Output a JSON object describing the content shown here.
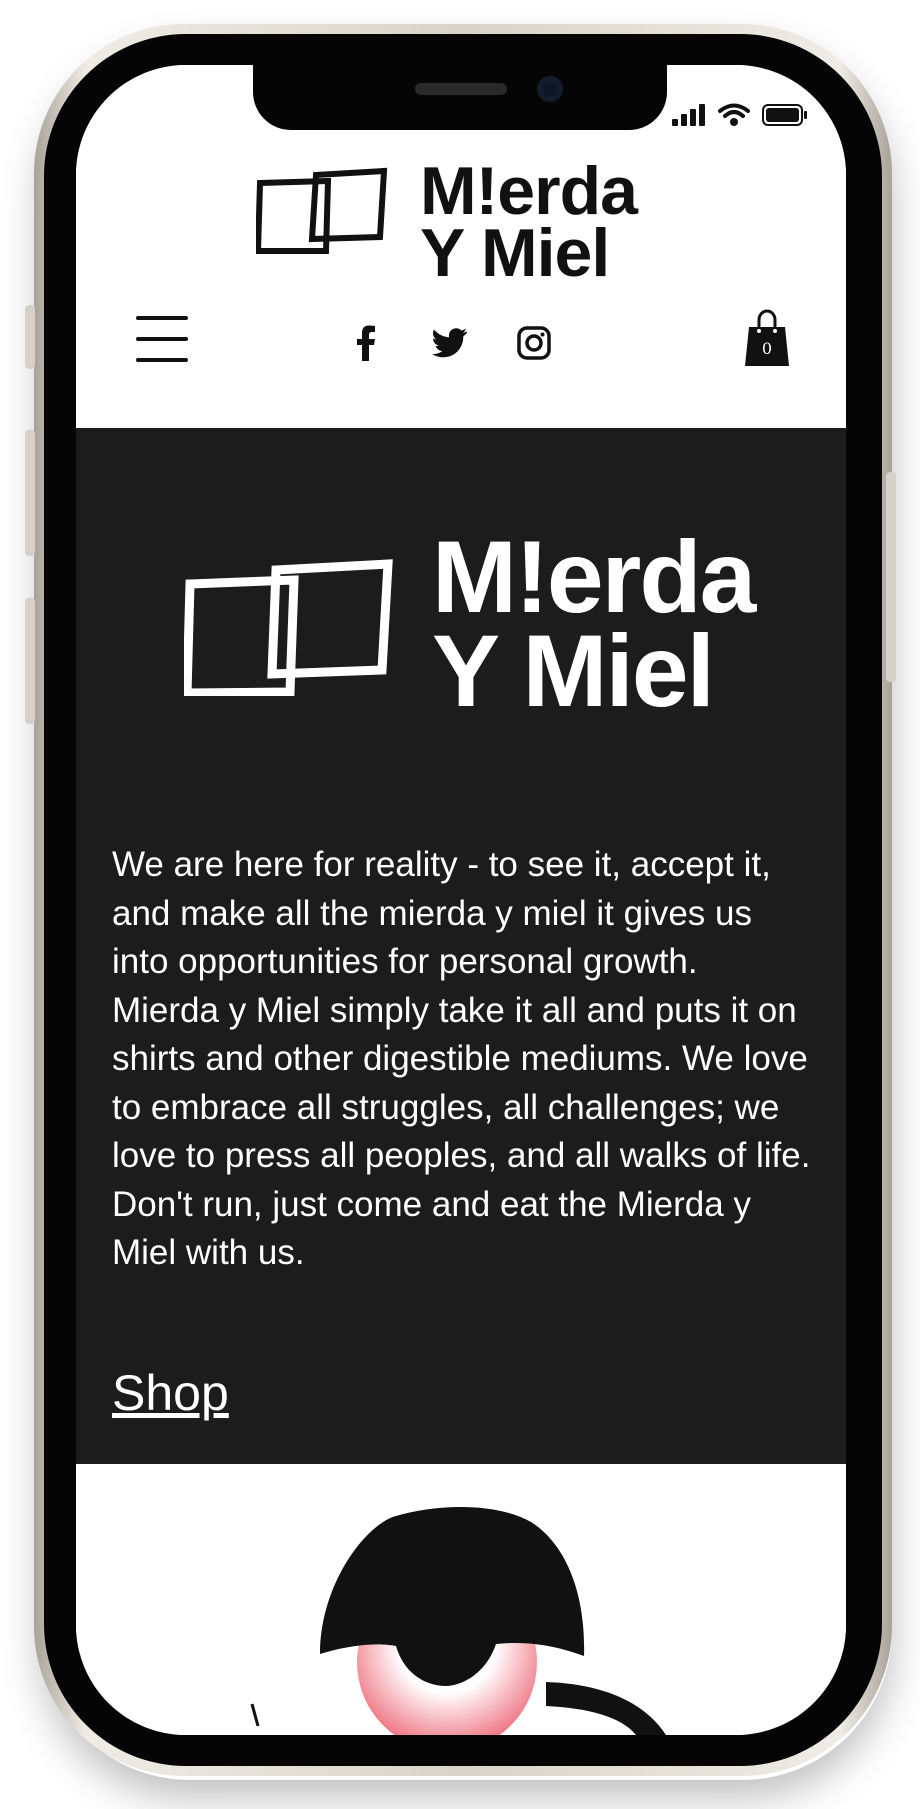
{
  "brand": {
    "name_line1": "M!erda",
    "name_line2": "Y Miel"
  },
  "header": {
    "cart_count": "0",
    "social": [
      "facebook-icon",
      "twitter-icon",
      "instagram-icon"
    ]
  },
  "about": {
    "text": "We are here for reality - to see it, accept it, and make all the mierda y miel it gives us into opportunities for personal growth. Mierda y Miel simply take it all and puts it on shirts and other digestible mediums. We love to embrace all struggles, all challenges; we love to press all peoples, and all walks of life. Don't run, just come and eat the Mierda y Miel with us."
  },
  "shop_label": "Shop",
  "colors": {
    "dark_section": "#1c1c1c",
    "text_light": "#ffffff",
    "text_dark": "#111111",
    "pink_accent": "#f07a86"
  }
}
